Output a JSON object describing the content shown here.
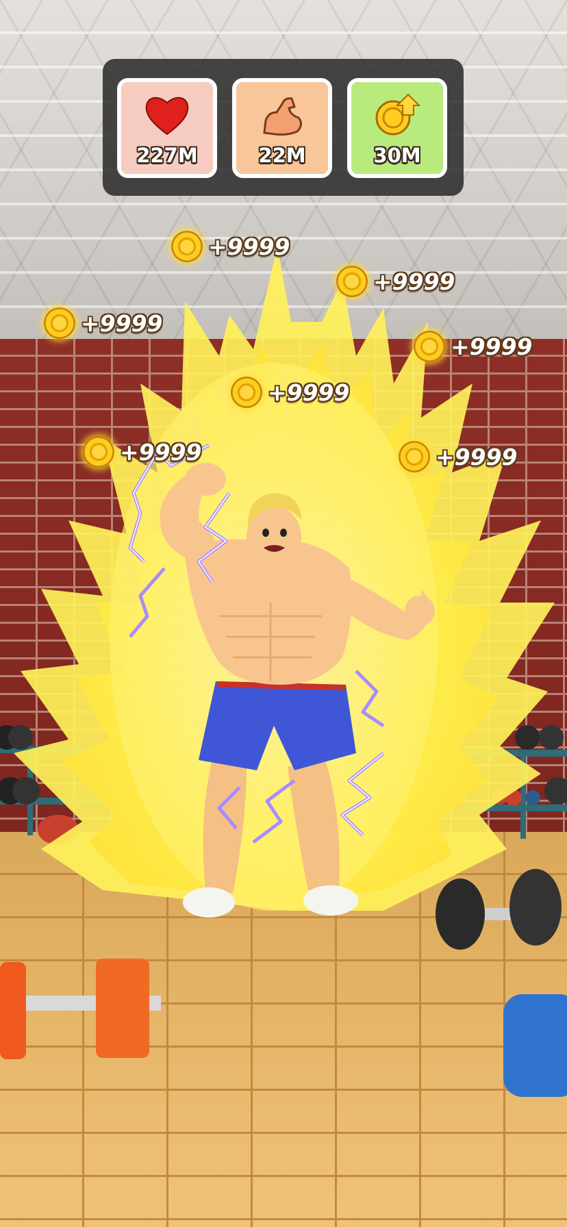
{
  "hud": {
    "stats": [
      {
        "icon": "heart-icon",
        "value": "227M",
        "bg": "#f7ccc0"
      },
      {
        "icon": "flexed-bicep-icon",
        "value": "22M",
        "bg": "#f9c699"
      },
      {
        "icon": "coin-upgrade-icon",
        "value": "30M",
        "bg": "#b9ea7d"
      }
    ]
  },
  "coin_popups": [
    {
      "amount": "+9999"
    },
    {
      "amount": "+9999"
    },
    {
      "amount": "+9999"
    },
    {
      "amount": "+9999"
    },
    {
      "amount": "+9999"
    },
    {
      "amount": "+9999"
    },
    {
      "amount": "+9999"
    }
  ],
  "colors": {
    "aura": "#fff46a",
    "lightning": "#9b7bff",
    "coin": "#ffcc22",
    "shorts": "#3f57d6",
    "skin": "#f8c58f"
  }
}
